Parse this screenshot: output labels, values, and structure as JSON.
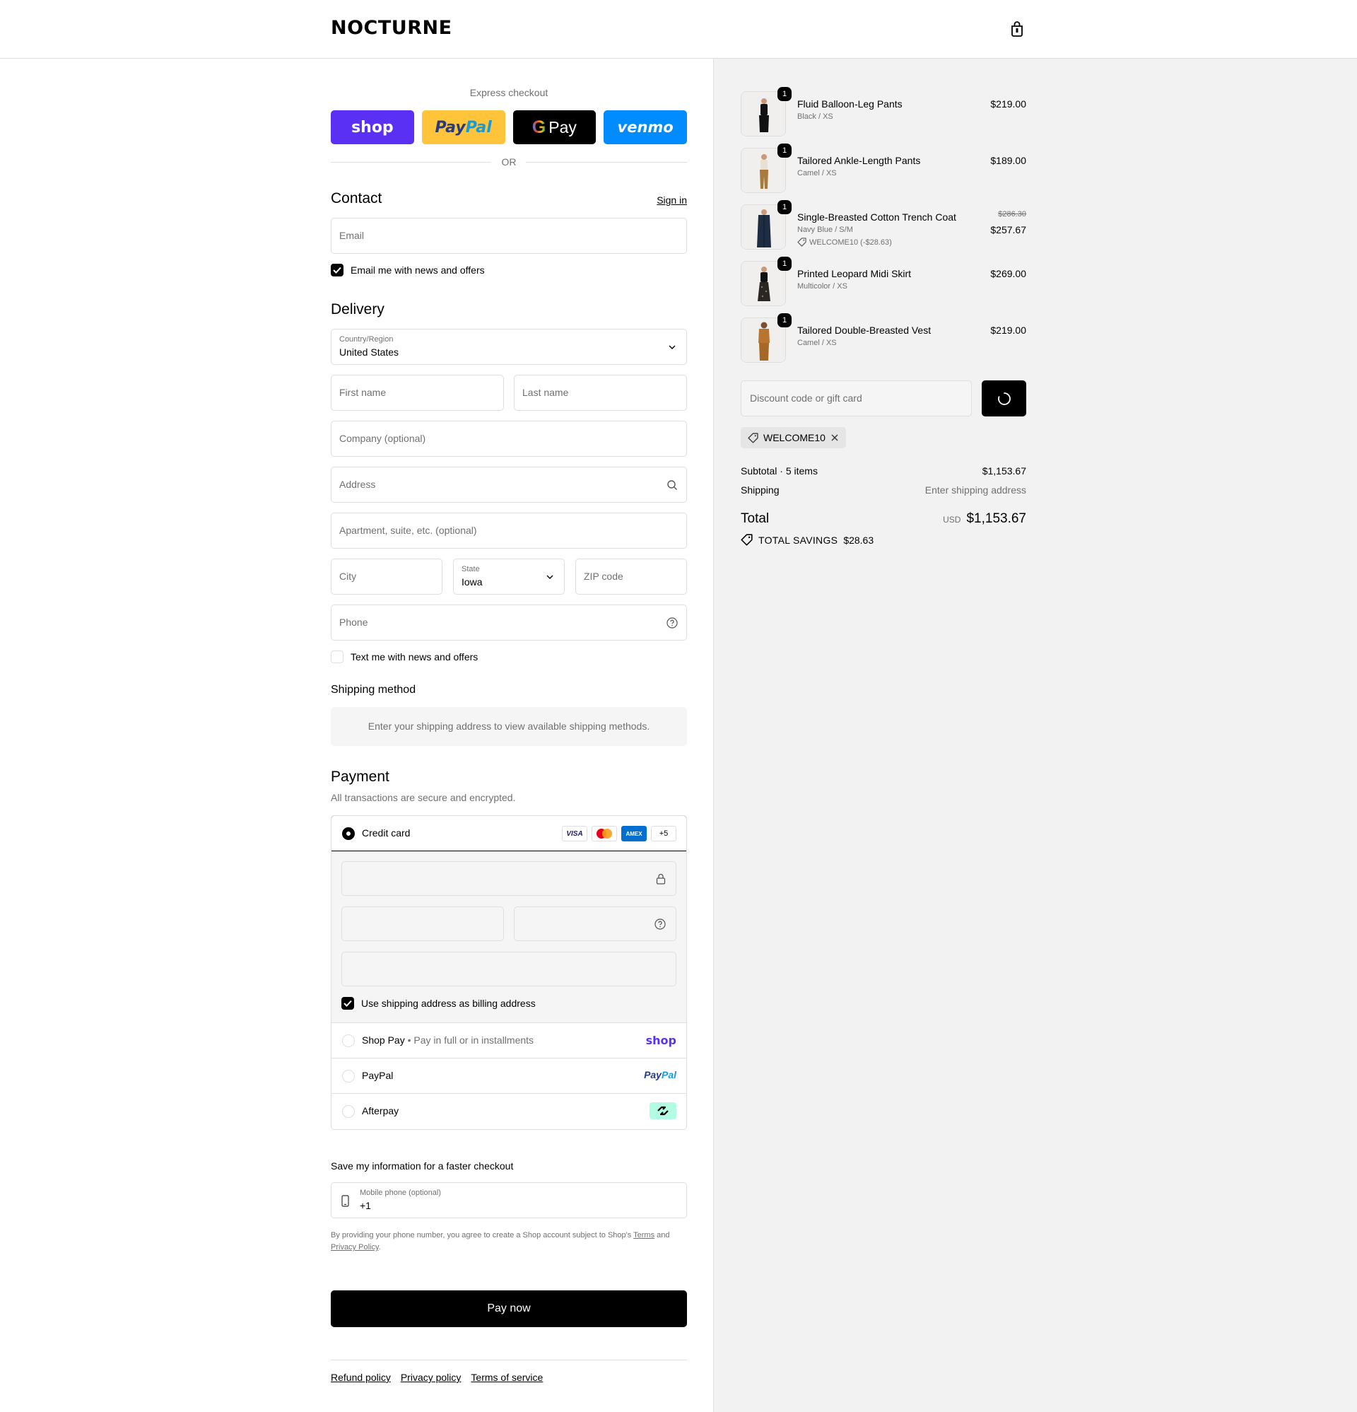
{
  "brand": "NOCTURNE",
  "express": {
    "title": "Express checkout",
    "buttons": [
      "shop",
      "PayPal",
      "Pay",
      "venmo"
    ],
    "or": "OR"
  },
  "contact": {
    "title": "Contact",
    "sign_in": "Sign in",
    "email_placeholder": "Email",
    "email_opt_in": "Email me with news and offers"
  },
  "delivery": {
    "title": "Delivery",
    "country_label": "Country/Region",
    "country_value": "United States",
    "first_name": "First name",
    "last_name": "Last name",
    "company": "Company (optional)",
    "address": "Address",
    "apartment": "Apartment, suite, etc. (optional)",
    "city": "City",
    "state_label": "State",
    "state_value": "Iowa",
    "zip": "ZIP code",
    "phone": "Phone",
    "sms_opt_in": "Text me with news and offers"
  },
  "shipping_method": {
    "title": "Shipping method",
    "message": "Enter your shipping address to view available shipping methods."
  },
  "payment": {
    "title": "Payment",
    "subtitle": "All transactions are secure and encrypted.",
    "credit_card": "Credit card",
    "card_brands": [
      "VISA",
      "AMEX",
      "+5"
    ],
    "billing_same": "Use shipping address as billing address",
    "options": [
      {
        "label": "Shop Pay",
        "sub": "Pay in full or in installments",
        "brand": "shop"
      },
      {
        "label": "PayPal",
        "sub": "",
        "brand": "PayPal"
      },
      {
        "label": "Afterpay",
        "sub": "",
        "brand": ""
      }
    ]
  },
  "save_info": {
    "title": "Save my information for a faster checkout",
    "mobile_label": "Mobile phone (optional)",
    "mobile_value": "+1",
    "legal_prefix": "By providing your phone number, you agree to create a Shop account subject to Shop's",
    "terms": "Terms",
    "and": "and",
    "privacy": "Privacy Policy",
    "period": "."
  },
  "pay_now": "Pay now",
  "footer": [
    "Refund policy",
    "Privacy policy",
    "Terms of service"
  ],
  "items": [
    {
      "name": "Fluid Balloon-Leg Pants",
      "variant": "Black / XS",
      "qty": "1",
      "price": "$219.00",
      "color": "#1a1a1a"
    },
    {
      "name": "Tailored Ankle-Length Pants",
      "variant": "Camel / XS",
      "qty": "1",
      "price": "$189.00",
      "color": "#a87a3d"
    },
    {
      "name": "Single-Breasted Cotton Trench Coat",
      "variant": "Navy Blue / S/M",
      "qty": "1",
      "old_price": "$286.30",
      "price": "$257.67",
      "discount": "WELCOME10 (-$28.63)",
      "color": "#1f2d44"
    },
    {
      "name": "Printed Leopard Midi Skirt",
      "variant": "Multicolor / XS",
      "qty": "1",
      "price": "$269.00",
      "color": "#2a2622"
    },
    {
      "name": "Tailored Double-Breasted Vest",
      "variant": "Camel / XS",
      "qty": "1",
      "price": "$219.00",
      "color": "#b8752e"
    }
  ],
  "discount": {
    "placeholder": "Discount code or gift card",
    "applied_code": "WELCOME10"
  },
  "summary": {
    "subtotal_label": "Subtotal · 5 items",
    "subtotal_value": "$1,153.67",
    "shipping_label": "Shipping",
    "shipping_value": "Enter shipping address",
    "total_label": "Total",
    "currency": "USD",
    "total_value": "$1,153.67",
    "savings_label": "TOTAL SAVINGS",
    "savings_value": "$28.63"
  }
}
